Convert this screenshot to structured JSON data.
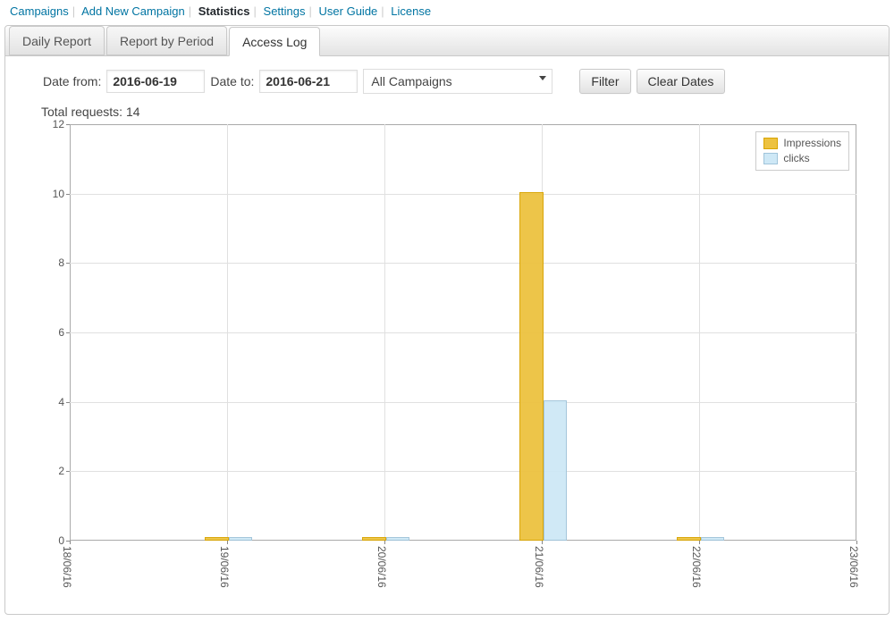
{
  "nav": {
    "items": [
      "Campaigns",
      "Add New Campaign",
      "Statistics",
      "Settings",
      "User Guide",
      "License"
    ],
    "active_index": 2,
    "separator": " | "
  },
  "tabs": {
    "items": [
      "Daily Report",
      "Report by Period",
      "Access Log"
    ],
    "active_index": 2
  },
  "controls": {
    "date_from_label": "Date from:",
    "date_from_value": "2016-06-19",
    "date_to_label": "Date to:",
    "date_to_value": "2016-06-21",
    "campaign_select": "All Campaigns",
    "filter_label": "Filter",
    "clear_label": "Clear Dates"
  },
  "total": {
    "label": "Total requests: ",
    "value": "14"
  },
  "legend": {
    "impressions": "Impressions",
    "clicks": "clicks"
  },
  "chart_data": {
    "type": "bar",
    "title": "",
    "xlabel": "",
    "ylabel": "",
    "ylim": [
      0,
      12
    ],
    "x_tick_labels": [
      "18/06/16",
      "19/06/16",
      "20/06/16",
      "21/06/16",
      "22/06/16",
      "23/06/16"
    ],
    "y_ticks": [
      0,
      2,
      4,
      6,
      8,
      10,
      12
    ],
    "categories": [
      "19/06/16",
      "20/06/16",
      "21/06/16",
      "22/06/16"
    ],
    "series": [
      {
        "name": "Impressions",
        "values": [
          0,
          0,
          10,
          0
        ],
        "color": "#edc240"
      },
      {
        "name": "clicks",
        "values": [
          0,
          0,
          4,
          0
        ],
        "color": "#cee8f6"
      }
    ]
  }
}
